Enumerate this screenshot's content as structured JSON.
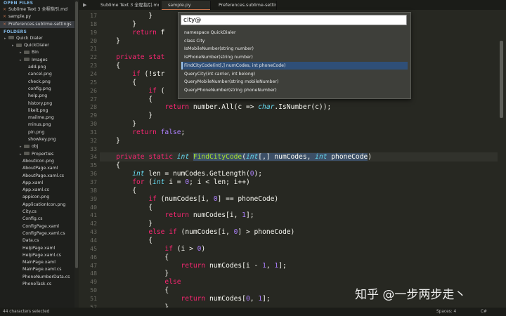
{
  "sidebar": {
    "open_files_header": "OPEN FILES",
    "open_files": [
      {
        "label": "Sublime Text 3 全程指引.md",
        "selected": false
      },
      {
        "label": "sample.py",
        "selected": false
      },
      {
        "label": "Preferences.sublime-settings",
        "selected": true
      }
    ],
    "folders_header": "FOLDERS",
    "tree": [
      {
        "label": "Quick Dialer",
        "level": 0,
        "type": "folder"
      },
      {
        "label": "QuickDialer",
        "level": 1,
        "type": "folder"
      },
      {
        "label": "Bin",
        "level": 2,
        "type": "folder"
      },
      {
        "label": "Images",
        "level": 2,
        "type": "folder"
      },
      {
        "label": "add.png",
        "level": 3,
        "type": "file"
      },
      {
        "label": "cancel.png",
        "level": 3,
        "type": "file"
      },
      {
        "label": "check.png",
        "level": 3,
        "type": "file"
      },
      {
        "label": "config.png",
        "level": 3,
        "type": "file"
      },
      {
        "label": "help.png",
        "level": 3,
        "type": "file"
      },
      {
        "label": "history.png",
        "level": 3,
        "type": "file"
      },
      {
        "label": "likeit.png",
        "level": 3,
        "type": "file"
      },
      {
        "label": "mailme.png",
        "level": 3,
        "type": "file"
      },
      {
        "label": "minus.png",
        "level": 3,
        "type": "file"
      },
      {
        "label": "pin.png",
        "level": 3,
        "type": "file"
      },
      {
        "label": "showkey.png",
        "level": 3,
        "type": "file"
      },
      {
        "label": "obj",
        "level": 2,
        "type": "folder"
      },
      {
        "label": "Properties",
        "level": 2,
        "type": "folder"
      },
      {
        "label": "AboutIcon.png",
        "level": 2,
        "type": "file"
      },
      {
        "label": "AboutPage.xaml",
        "level": 2,
        "type": "file"
      },
      {
        "label": "AboutPage.xaml.cs",
        "level": 2,
        "type": "file"
      },
      {
        "label": "App.xaml",
        "level": 2,
        "type": "file"
      },
      {
        "label": "App.xaml.cs",
        "level": 2,
        "type": "file"
      },
      {
        "label": "appicon.png",
        "level": 2,
        "type": "file"
      },
      {
        "label": "ApplicationIcon.png",
        "level": 2,
        "type": "file"
      },
      {
        "label": "City.cs",
        "level": 2,
        "type": "file"
      },
      {
        "label": "Config.cs",
        "level": 2,
        "type": "file"
      },
      {
        "label": "ConfigPage.xaml",
        "level": 2,
        "type": "file"
      },
      {
        "label": "ConfigPage.xaml.cs",
        "level": 2,
        "type": "file"
      },
      {
        "label": "Data.cs",
        "level": 2,
        "type": "file"
      },
      {
        "label": "HelpPage.xaml",
        "level": 2,
        "type": "file"
      },
      {
        "label": "HelpPage.xaml.cs",
        "level": 2,
        "type": "file"
      },
      {
        "label": "MainPage.xaml",
        "level": 2,
        "type": "file"
      },
      {
        "label": "MainPage.xaml.cs",
        "level": 2,
        "type": "file"
      },
      {
        "label": "PhoneNumberData.cs",
        "level": 2,
        "type": "file"
      },
      {
        "label": "PhoneTask.cs",
        "level": 2,
        "type": "file"
      }
    ]
  },
  "tabs": [
    {
      "label": "Sublime Text 3 全程指引.md",
      "active": false
    },
    {
      "label": "sample.py",
      "active": true
    },
    {
      "label": "Preferences.sublime-settings",
      "active": false
    }
  ],
  "goto_popup": {
    "query": "city@",
    "items": [
      {
        "label": "namespace QuickDialer",
        "selected": false
      },
      {
        "label": "class City",
        "selected": false
      },
      {
        "label": "IsMobileNumber(string number)",
        "selected": false
      },
      {
        "label": "IsPhoneNumber(string number)",
        "selected": false
      },
      {
        "label": "FindCityCode(int[,] numCodes, int phoneCode)",
        "selected": true
      },
      {
        "label": "QueryCity(int carrier, int belong)",
        "selected": false
      },
      {
        "label": "QueryMobileNumber(string mobileNumber)",
        "selected": false
      },
      {
        "label": "QueryPhoneNumber(string phoneNumber)",
        "selected": false
      }
    ]
  },
  "editor": {
    "line_numbers": [
      "17",
      "18",
      "19",
      "20",
      "21",
      "22",
      "23",
      "24",
      "25",
      "26",
      "27",
      "28",
      "29",
      "30",
      "31",
      "32",
      "33",
      "34",
      "35",
      "36",
      "37",
      "38",
      "39",
      "40",
      "41",
      "42",
      "43",
      "44",
      "45",
      "46",
      "47",
      "48",
      "49",
      "50",
      "51",
      "52"
    ],
    "lines": [
      [
        {
          "t": "            }"
        }
      ],
      [
        {
          "t": "        }"
        }
      ],
      [
        {
          "t": "        "
        },
        {
          "t": "return",
          "c": "kw"
        },
        {
          "t": " f"
        }
      ],
      [
        {
          "t": "    }"
        }
      ],
      [
        {
          "t": ""
        }
      ],
      [
        {
          "t": "    "
        },
        {
          "t": "private",
          "c": "kw"
        },
        {
          "t": " "
        },
        {
          "t": "stat",
          "c": "kw"
        }
      ],
      [
        {
          "t": "    {"
        }
      ],
      [
        {
          "t": "        "
        },
        {
          "t": "if",
          "c": "kw"
        },
        {
          "t": " (!str"
        }
      ],
      [
        {
          "t": "        {"
        }
      ],
      [
        {
          "t": "            "
        },
        {
          "t": "if",
          "c": "kw"
        },
        {
          "t": " ("
        }
      ],
      [
        {
          "t": "            {"
        }
      ],
      [
        {
          "t": "                "
        },
        {
          "t": "return",
          "c": "kw"
        },
        {
          "t": " number.All(c => "
        },
        {
          "t": "char",
          "c": "ty"
        },
        {
          "t": ".IsNumber(c));"
        }
      ],
      [
        {
          "t": "            }"
        }
      ],
      [
        {
          "t": "        }"
        }
      ],
      [
        {
          "t": "        "
        },
        {
          "t": "return",
          "c": "kw"
        },
        {
          "t": " "
        },
        {
          "t": "false",
          "c": "nm"
        },
        {
          "t": ";"
        }
      ],
      [
        {
          "t": "    }"
        }
      ],
      [
        {
          "t": ""
        }
      ],
      [
        {
          "t": "    "
        },
        {
          "t": "private",
          "c": "kw"
        },
        {
          "t": " "
        },
        {
          "t": "static",
          "c": "kw"
        },
        {
          "t": " "
        },
        {
          "t": "int",
          "c": "ty"
        },
        {
          "t": " "
        },
        {
          "t": "FindCityCode",
          "c": "fn sel-tok"
        },
        {
          "t": "(",
          "c": "sel-tok"
        },
        {
          "t": "int",
          "c": "ty sel-tok"
        },
        {
          "t": "[,] numCodes, ",
          "c": "sel-tok"
        },
        {
          "t": "int",
          "c": "ty sel-tok"
        },
        {
          "t": " phoneCode",
          "c": "sel-tok"
        },
        {
          "t": ")"
        }
      ],
      [
        {
          "t": "    {"
        }
      ],
      [
        {
          "t": "        "
        },
        {
          "t": "int",
          "c": "ty"
        },
        {
          "t": " len = numCodes.GetLength("
        },
        {
          "t": "0",
          "c": "nm"
        },
        {
          "t": ");"
        }
      ],
      [
        {
          "t": "        "
        },
        {
          "t": "for",
          "c": "kw"
        },
        {
          "t": " ("
        },
        {
          "t": "int",
          "c": "ty"
        },
        {
          "t": " i = "
        },
        {
          "t": "0",
          "c": "nm"
        },
        {
          "t": "; i < len; i++)"
        }
      ],
      [
        {
          "t": "        {"
        }
      ],
      [
        {
          "t": "            "
        },
        {
          "t": "if",
          "c": "kw"
        },
        {
          "t": " (numCodes[i, "
        },
        {
          "t": "0",
          "c": "nm"
        },
        {
          "t": "] == phoneCode)"
        }
      ],
      [
        {
          "t": "            {"
        }
      ],
      [
        {
          "t": "                "
        },
        {
          "t": "return",
          "c": "kw"
        },
        {
          "t": " numCodes[i, "
        },
        {
          "t": "1",
          "c": "nm"
        },
        {
          "t": "];"
        }
      ],
      [
        {
          "t": "            }"
        }
      ],
      [
        {
          "t": "            "
        },
        {
          "t": "else",
          "c": "kw"
        },
        {
          "t": " "
        },
        {
          "t": "if",
          "c": "kw"
        },
        {
          "t": " (numCodes[i, "
        },
        {
          "t": "0",
          "c": "nm"
        },
        {
          "t": "] > phoneCode)"
        }
      ],
      [
        {
          "t": "            {"
        }
      ],
      [
        {
          "t": "                "
        },
        {
          "t": "if",
          "c": "kw"
        },
        {
          "t": " (i > "
        },
        {
          "t": "0",
          "c": "nm"
        },
        {
          "t": ")"
        }
      ],
      [
        {
          "t": "                {"
        }
      ],
      [
        {
          "t": "                    "
        },
        {
          "t": "return",
          "c": "kw"
        },
        {
          "t": " numCodes[i - "
        },
        {
          "t": "1",
          "c": "nm"
        },
        {
          "t": ", "
        },
        {
          "t": "1",
          "c": "nm"
        },
        {
          "t": "];"
        }
      ],
      [
        {
          "t": "                }"
        }
      ],
      [
        {
          "t": "                "
        },
        {
          "t": "else",
          "c": "kw"
        }
      ],
      [
        {
          "t": "                {"
        }
      ],
      [
        {
          "t": "                    "
        },
        {
          "t": "return",
          "c": "kw"
        },
        {
          "t": " numCodes["
        },
        {
          "t": "0",
          "c": "nm"
        },
        {
          "t": ", "
        },
        {
          "t": "1",
          "c": "nm"
        },
        {
          "t": "];"
        }
      ],
      [
        {
          "t": "                }"
        }
      ]
    ]
  },
  "status": {
    "left": "44 characters selected",
    "spaces": "Spaces: 4",
    "syntax": "C#"
  },
  "watermark": "知乎 @一步两步走丶",
  "icons": {
    "run": "play-icon",
    "close": "close-icon",
    "folder": "folder-icon"
  },
  "colors": {
    "background": "#272822",
    "keyword": "#f92672",
    "type": "#66d9ef",
    "function": "#a6e22e",
    "number": "#ae81ff",
    "selection": "#2f4f78"
  }
}
